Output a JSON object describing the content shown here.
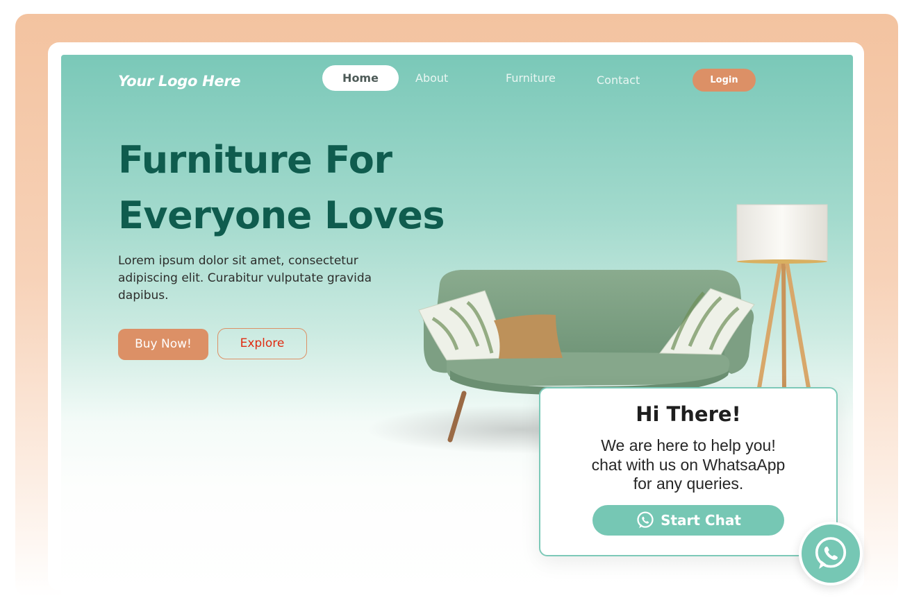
{
  "brand": {
    "logo": "Your Logo Here"
  },
  "nav": {
    "items": [
      {
        "label": "Home",
        "active": true
      },
      {
        "label": "About",
        "active": false
      },
      {
        "label": "Furniture",
        "active": false
      },
      {
        "label": "Contact",
        "active": false
      }
    ],
    "login_label": "Login"
  },
  "hero": {
    "title_line1": "Furniture For",
    "title_line2": "Everyone Loves",
    "description": "Lorem ipsum dolor sit amet, consectetur adipiscing elit. Curabitur vulputate gravida dapibus.",
    "buy_label": "Buy Now!",
    "explore_label": "Explore"
  },
  "chat": {
    "title": "Hi There!",
    "line1": "We are here to help you!",
    "line2": "chat with us on WhatsaApp",
    "line3": "for any queries.",
    "button_label": "Start Chat",
    "button_icon": "whatsapp-icon",
    "fab_icon": "whatsapp-icon"
  },
  "colors": {
    "accent": "#dc9066",
    "teal": "#76c7b4",
    "headline": "#0f5c4e",
    "explore_text": "#e02a10"
  }
}
